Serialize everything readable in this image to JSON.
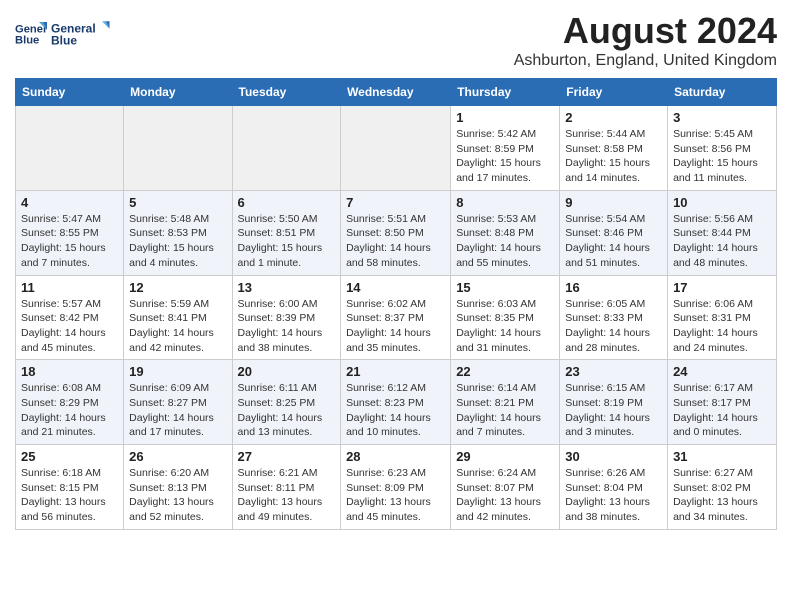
{
  "header": {
    "logo_line1": "General",
    "logo_line2": "Blue",
    "month": "August 2024",
    "location": "Ashburton, England, United Kingdom"
  },
  "weekdays": [
    "Sunday",
    "Monday",
    "Tuesday",
    "Wednesday",
    "Thursday",
    "Friday",
    "Saturday"
  ],
  "weeks": [
    [
      {
        "day": "",
        "info": ""
      },
      {
        "day": "",
        "info": ""
      },
      {
        "day": "",
        "info": ""
      },
      {
        "day": "",
        "info": ""
      },
      {
        "day": "1",
        "info": "Sunrise: 5:42 AM\nSunset: 8:59 PM\nDaylight: 15 hours and 17 minutes."
      },
      {
        "day": "2",
        "info": "Sunrise: 5:44 AM\nSunset: 8:58 PM\nDaylight: 15 hours and 14 minutes."
      },
      {
        "day": "3",
        "info": "Sunrise: 5:45 AM\nSunset: 8:56 PM\nDaylight: 15 hours and 11 minutes."
      }
    ],
    [
      {
        "day": "4",
        "info": "Sunrise: 5:47 AM\nSunset: 8:55 PM\nDaylight: 15 hours and 7 minutes."
      },
      {
        "day": "5",
        "info": "Sunrise: 5:48 AM\nSunset: 8:53 PM\nDaylight: 15 hours and 4 minutes."
      },
      {
        "day": "6",
        "info": "Sunrise: 5:50 AM\nSunset: 8:51 PM\nDaylight: 15 hours and 1 minute."
      },
      {
        "day": "7",
        "info": "Sunrise: 5:51 AM\nSunset: 8:50 PM\nDaylight: 14 hours and 58 minutes."
      },
      {
        "day": "8",
        "info": "Sunrise: 5:53 AM\nSunset: 8:48 PM\nDaylight: 14 hours and 55 minutes."
      },
      {
        "day": "9",
        "info": "Sunrise: 5:54 AM\nSunset: 8:46 PM\nDaylight: 14 hours and 51 minutes."
      },
      {
        "day": "10",
        "info": "Sunrise: 5:56 AM\nSunset: 8:44 PM\nDaylight: 14 hours and 48 minutes."
      }
    ],
    [
      {
        "day": "11",
        "info": "Sunrise: 5:57 AM\nSunset: 8:42 PM\nDaylight: 14 hours and 45 minutes."
      },
      {
        "day": "12",
        "info": "Sunrise: 5:59 AM\nSunset: 8:41 PM\nDaylight: 14 hours and 42 minutes."
      },
      {
        "day": "13",
        "info": "Sunrise: 6:00 AM\nSunset: 8:39 PM\nDaylight: 14 hours and 38 minutes."
      },
      {
        "day": "14",
        "info": "Sunrise: 6:02 AM\nSunset: 8:37 PM\nDaylight: 14 hours and 35 minutes."
      },
      {
        "day": "15",
        "info": "Sunrise: 6:03 AM\nSunset: 8:35 PM\nDaylight: 14 hours and 31 minutes."
      },
      {
        "day": "16",
        "info": "Sunrise: 6:05 AM\nSunset: 8:33 PM\nDaylight: 14 hours and 28 minutes."
      },
      {
        "day": "17",
        "info": "Sunrise: 6:06 AM\nSunset: 8:31 PM\nDaylight: 14 hours and 24 minutes."
      }
    ],
    [
      {
        "day": "18",
        "info": "Sunrise: 6:08 AM\nSunset: 8:29 PM\nDaylight: 14 hours and 21 minutes."
      },
      {
        "day": "19",
        "info": "Sunrise: 6:09 AM\nSunset: 8:27 PM\nDaylight: 14 hours and 17 minutes."
      },
      {
        "day": "20",
        "info": "Sunrise: 6:11 AM\nSunset: 8:25 PM\nDaylight: 14 hours and 13 minutes."
      },
      {
        "day": "21",
        "info": "Sunrise: 6:12 AM\nSunset: 8:23 PM\nDaylight: 14 hours and 10 minutes."
      },
      {
        "day": "22",
        "info": "Sunrise: 6:14 AM\nSunset: 8:21 PM\nDaylight: 14 hours and 7 minutes."
      },
      {
        "day": "23",
        "info": "Sunrise: 6:15 AM\nSunset: 8:19 PM\nDaylight: 14 hours and 3 minutes."
      },
      {
        "day": "24",
        "info": "Sunrise: 6:17 AM\nSunset: 8:17 PM\nDaylight: 14 hours and 0 minutes."
      }
    ],
    [
      {
        "day": "25",
        "info": "Sunrise: 6:18 AM\nSunset: 8:15 PM\nDaylight: 13 hours and 56 minutes."
      },
      {
        "day": "26",
        "info": "Sunrise: 6:20 AM\nSunset: 8:13 PM\nDaylight: 13 hours and 52 minutes."
      },
      {
        "day": "27",
        "info": "Sunrise: 6:21 AM\nSunset: 8:11 PM\nDaylight: 13 hours and 49 minutes."
      },
      {
        "day": "28",
        "info": "Sunrise: 6:23 AM\nSunset: 8:09 PM\nDaylight: 13 hours and 45 minutes."
      },
      {
        "day": "29",
        "info": "Sunrise: 6:24 AM\nSunset: 8:07 PM\nDaylight: 13 hours and 42 minutes."
      },
      {
        "day": "30",
        "info": "Sunrise: 6:26 AM\nSunset: 8:04 PM\nDaylight: 13 hours and 38 minutes."
      },
      {
        "day": "31",
        "info": "Sunrise: 6:27 AM\nSunset: 8:02 PM\nDaylight: 13 hours and 34 minutes."
      }
    ]
  ]
}
